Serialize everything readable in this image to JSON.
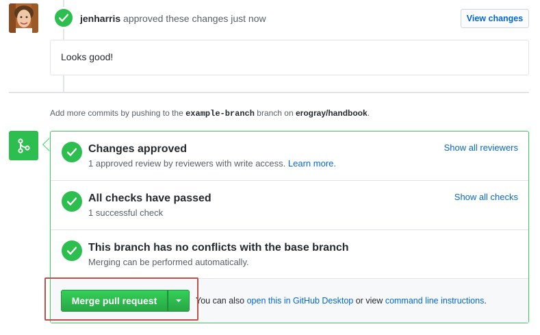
{
  "review": {
    "author": "jenharris",
    "action_text": "approved these changes just now",
    "view_changes_label": "View changes",
    "comment": "Looks good!"
  },
  "push_note": {
    "prefix": "Add more commits by pushing to the",
    "branch": "example-branch",
    "middle": "branch on",
    "repo": "erogray/handbook",
    "suffix": "."
  },
  "checks": [
    {
      "title": "Changes approved",
      "description": "1 approved review by reviewers with write access.",
      "description_link": "Learn more.",
      "right_link": "Show all reviewers"
    },
    {
      "title": "All checks have passed",
      "description": "1 successful check",
      "right_link": "Show all checks"
    },
    {
      "title": "This branch has no conflicts with the base branch",
      "description": "Merging can be performed automatically."
    }
  ],
  "merge": {
    "button_label": "Merge pull request",
    "note_prefix": "You can also",
    "desktop_link": "open this in GitHub Desktop",
    "note_middle": "or view",
    "cli_link": "command line instructions",
    "note_suffix": "."
  },
  "colors": {
    "success_green": "#2cbe4e",
    "link_blue": "#0366d6",
    "highlight_red": "#c0504d"
  }
}
